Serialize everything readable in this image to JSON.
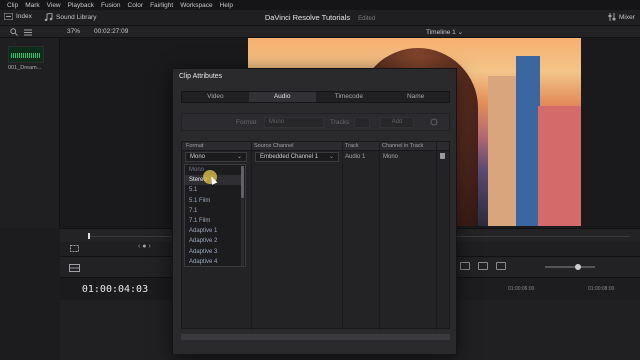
{
  "menu": [
    "Clip",
    "Mark",
    "View",
    "Playback",
    "Fusion",
    "Color",
    "Fairlight",
    "Workspace",
    "Help"
  ],
  "toolbar": {
    "index": "Index",
    "sound_library": "Sound Library",
    "project_title": "DaVinci Resolve Tutorials",
    "edited": "Edited",
    "mixer": "Mixer"
  },
  "subbar": {
    "zoom": "37%",
    "timecode": "00:02:27:09",
    "timeline": "Timeline 1"
  },
  "media_pool": {
    "clip_name": "001_Dream..."
  },
  "timeline": {
    "timecode": "01:00:04:03",
    "ruler_ticks": [
      "01:00:06:00",
      "01:00:08:00"
    ]
  },
  "dialog": {
    "title": "Clip Attributes",
    "tabs": [
      "Video",
      "Audio",
      "Timecode",
      "Name"
    ],
    "active_tab": "Audio",
    "format_row": {
      "format_label": "Format",
      "format_value": "Mono",
      "tracks_label": "Tracks",
      "add_label": "Add"
    },
    "columns": [
      "Format",
      "Source Channel",
      "Track",
      "Channel in Track"
    ],
    "row": {
      "format": "Mono",
      "source_channel": "Embedded Channel 1",
      "track": "Audio 1",
      "channel_in_track": "Mono"
    },
    "dropdown": {
      "options": [
        "Mono",
        "Stereo",
        "5.1",
        "5.1 Film",
        "7.1",
        "7.1 Film",
        "Adaptive 1",
        "Adaptive 2",
        "Adaptive 3",
        "Adaptive 4"
      ],
      "highlighted": "Stereo"
    }
  },
  "colors": {
    "accent": "#e8c850",
    "waveform": "#2fc06a",
    "panel": "#2a2a2d"
  }
}
